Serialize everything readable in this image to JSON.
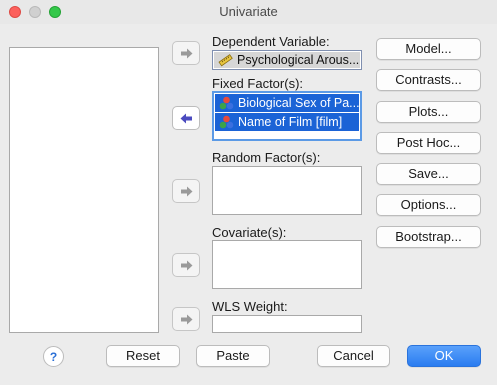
{
  "window": {
    "title": "Univariate"
  },
  "labels": {
    "dependent": "Dependent Variable:",
    "fixed": "Fixed Factor(s):",
    "random": "Random Factor(s):",
    "covariate": "Covariate(s):",
    "wls": "WLS Weight:"
  },
  "dependent_variable": {
    "name": "Psychological Arous...",
    "icon": "ruler-icon"
  },
  "fixed_factors": [
    {
      "name": "Biological Sex of Pa...",
      "icon": "nominal-icon",
      "selected": true
    },
    {
      "name": "Name of Film [film]",
      "icon": "nominal-icon",
      "selected": true
    }
  ],
  "side_buttons": [
    "Model...",
    "Contrasts...",
    "Plots...",
    "Post Hoc...",
    "Save...",
    "Options...",
    "Bootstrap..."
  ],
  "bottom_buttons": {
    "help": "?",
    "reset": "Reset",
    "paste": "Paste",
    "cancel": "Cancel",
    "ok": "OK"
  },
  "colors": {
    "accent": "#2f82f5",
    "selection": "#1b63d6"
  }
}
